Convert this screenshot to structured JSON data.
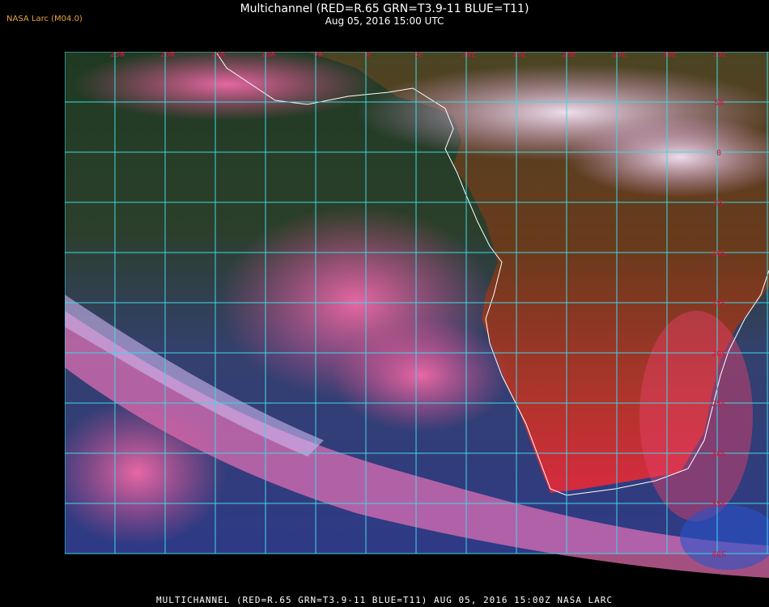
{
  "header": {
    "credit": "NASA Larc (M04.0)",
    "title": "Multichannel (RED=R.65 GRN=T3.9-11 BLUE=T11)",
    "subtitle": "Aug 05, 2016 15:00 UTC"
  },
  "map": {
    "lon_labels": [
      "25W",
      "20W",
      "15W",
      "10W",
      "5W",
      "0",
      "5E",
      "10E",
      "15E",
      "20E",
      "25E",
      "30E",
      "35E"
    ],
    "lat_labels": [
      "5N",
      "0",
      "5S",
      "10S",
      "15S",
      "20S",
      "25S",
      "30S",
      "35S",
      "40S"
    ],
    "colors": {
      "grid": "#3fd8e6",
      "coastline": "#ffffff",
      "labels": "#e0103a",
      "ocean": "#2e3a7a",
      "land": "#6b3a1e",
      "cloud_pink": "#e85a9a",
      "cloud_white": "#f2d8f0"
    }
  },
  "footer": {
    "caption": "MULTICHANNEL (RED=R.65 GRN=T3.9-11 BLUE=T11) AUG 05, 2016 15:00Z   NASA LARC"
  }
}
